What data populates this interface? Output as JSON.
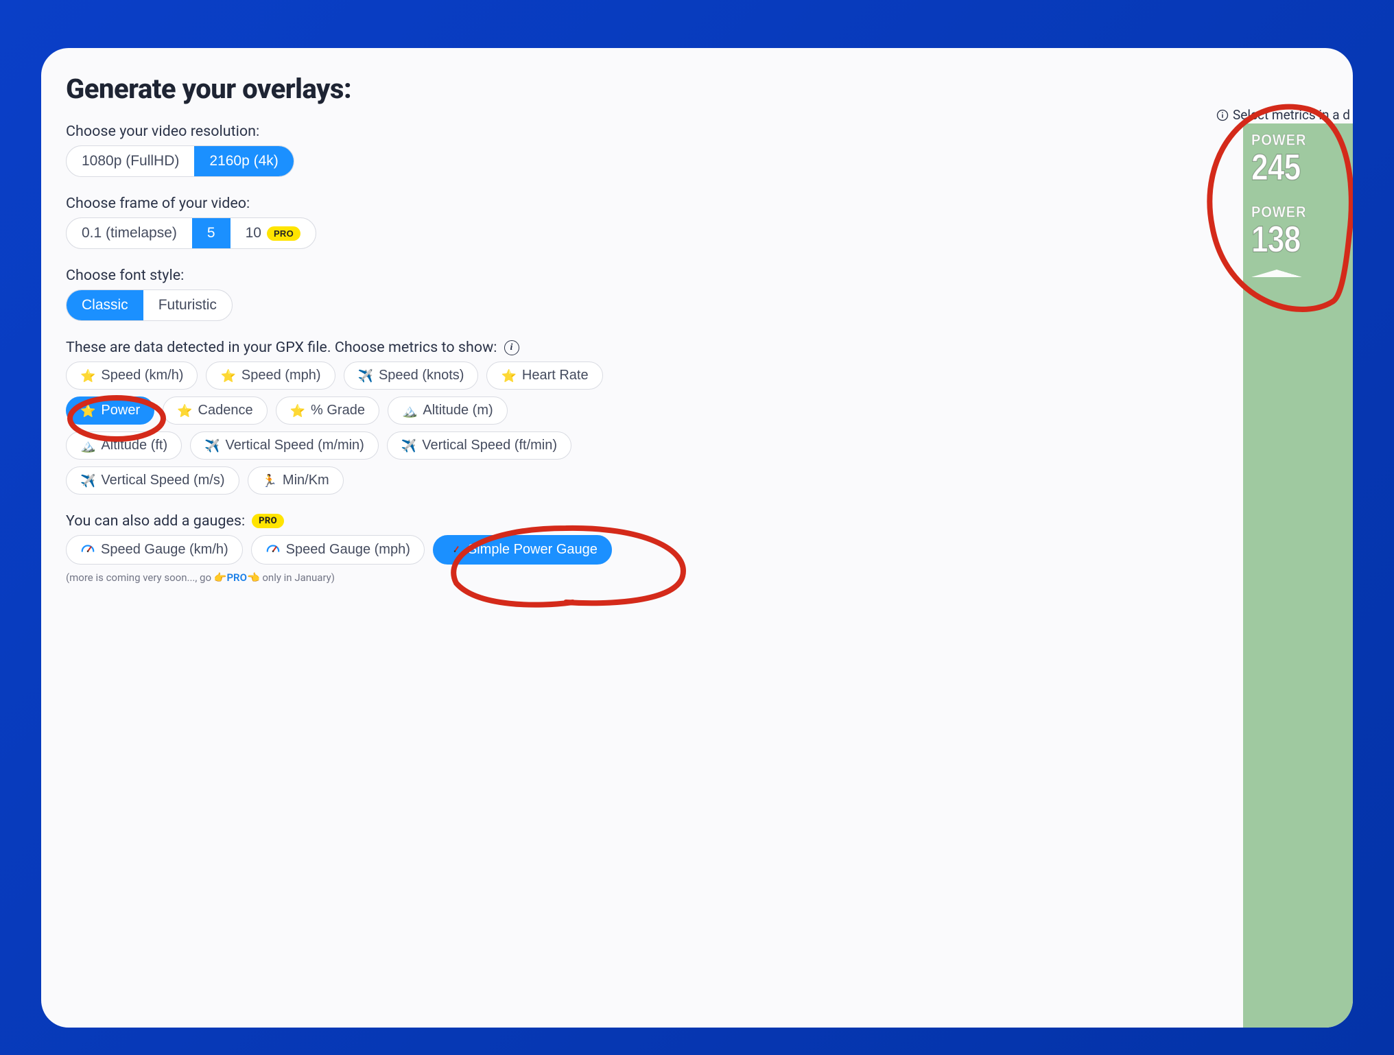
{
  "title": "Generate your overlays:",
  "resolution": {
    "label": "Choose your video resolution:",
    "options": [
      "1080p (FullHD)",
      "2160p (4k)"
    ],
    "active": 1
  },
  "framerate": {
    "label": "Choose frame of your video:",
    "options": [
      "0.1 (timelapse)",
      "5",
      "10"
    ],
    "active": 1,
    "pro_label": "PRO"
  },
  "fontstyle": {
    "label": "Choose font style:",
    "options": [
      "Classic",
      "Futuristic"
    ],
    "active": 0
  },
  "metrics": {
    "label": "These are data detected in your GPX file. Choose metrics to show:",
    "items": [
      {
        "icon": "⭐",
        "label": "Speed (km/h)",
        "active": false
      },
      {
        "icon": "⭐",
        "label": "Speed (mph)",
        "active": false
      },
      {
        "icon": "✈️",
        "label": "Speed (knots)",
        "active": false
      },
      {
        "icon": "⭐",
        "label": "Heart Rate",
        "active": false
      },
      {
        "icon": "⭐",
        "label": "Power",
        "active": true
      },
      {
        "icon": "⭐",
        "label": "Cadence",
        "active": false
      },
      {
        "icon": "⭐",
        "label": "% Grade",
        "active": false
      },
      {
        "icon": "🏔️",
        "label": "Altitude (m)",
        "active": false
      },
      {
        "icon": "🏔️",
        "label": "Altitude (ft)",
        "active": false
      },
      {
        "icon": "✈️",
        "label": "Vertical Speed (m/min)",
        "active": false
      },
      {
        "icon": "✈️",
        "label": "Vertical Speed (ft/min)",
        "active": false
      },
      {
        "icon": "✈️",
        "label": "Vertical Speed (m/s)",
        "active": false
      },
      {
        "icon": "🏃",
        "label": "Min/Km",
        "active": false
      }
    ]
  },
  "gauges": {
    "label": "You can also add a gauges:",
    "pro_label": "PRO",
    "items": [
      {
        "icon": "dial",
        "label": "Speed Gauge (km/h)",
        "active": false
      },
      {
        "icon": "dial",
        "label": "Speed Gauge (mph)",
        "active": false
      },
      {
        "icon": "dial",
        "label": "Simple Power Gauge",
        "active": true
      }
    ]
  },
  "footnote": {
    "prefix": "(more is coming very soon..., go ",
    "hand_left": "👉",
    "pro": "PRO",
    "hand_right": "👈",
    "suffix": " only in January)"
  },
  "preview": {
    "link_text": "Select metrics in a d",
    "metric1": {
      "title": "POWER",
      "value": "245"
    },
    "metric2": {
      "title": "POWER",
      "value": "138"
    }
  }
}
